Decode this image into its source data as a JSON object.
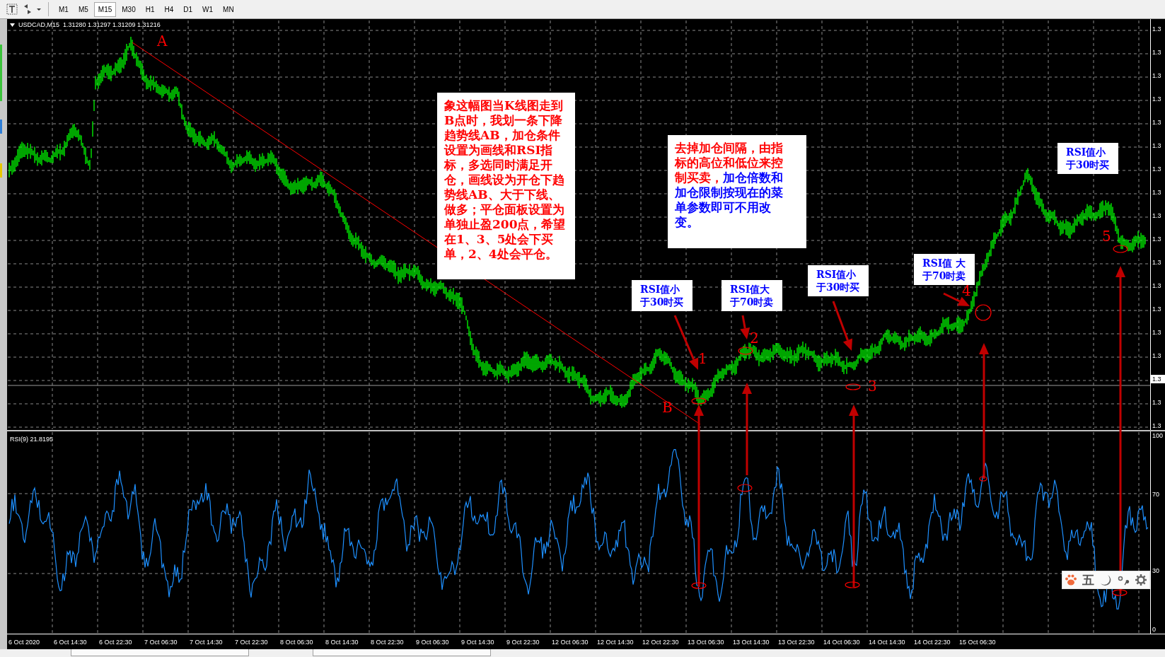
{
  "toolbar": {
    "timeframes": [
      {
        "label": "M1",
        "selected": false
      },
      {
        "label": "M5",
        "selected": false
      },
      {
        "label": "M15",
        "selected": true
      },
      {
        "label": "M30",
        "selected": false
      },
      {
        "label": "H1",
        "selected": false
      },
      {
        "label": "H4",
        "selected": false
      },
      {
        "label": "D1",
        "selected": false
      },
      {
        "label": "W1",
        "selected": false
      },
      {
        "label": "MN",
        "selected": false
      }
    ]
  },
  "chart": {
    "header": "USDCAD,M15  1.31280 1.31297 1.31209 1.31216",
    "price_axis": [
      {
        "label": "1.3",
        "current": false
      },
      {
        "label": "1.3",
        "current": false
      },
      {
        "label": "1.3",
        "current": false
      },
      {
        "label": "1.3",
        "current": false
      },
      {
        "label": "1.3",
        "current": false
      },
      {
        "label": "1.3",
        "current": false
      },
      {
        "label": "1.3",
        "current": false
      },
      {
        "label": "1.3",
        "current": false
      },
      {
        "label": "1.3",
        "current": false
      },
      {
        "label": "1.3",
        "current": false
      },
      {
        "label": "1.3",
        "current": false
      },
      {
        "label": "1.3",
        "current": false
      },
      {
        "label": "1.3",
        "current": false
      },
      {
        "label": "1.3",
        "current": false
      },
      {
        "label": "1.3",
        "current": false
      },
      {
        "label": "1.3",
        "current": true
      },
      {
        "label": "1.3",
        "current": false
      },
      {
        "label": "1.3",
        "current": false
      }
    ],
    "point_labels": [
      "A",
      "B",
      "1",
      "2",
      "3",
      "4",
      "5"
    ],
    "notes": [
      {
        "segments": [
          {
            "text": "象这幅图当K线图走到B点时，我划一条下降趋势线AB，加仓条件设置为画线和RSI指标，多选同时满足开仓，画线设为开仓下趋势线AB、大于下线、做多；平仓面板设置为单独止盈200点，希望在1、3、5处会下买单，2、4处会平仓。",
            "color": "#ff0000"
          }
        ]
      },
      {
        "segments": [
          {
            "text": "去掉加仓间隔，由指标的高位和低位来控制买卖，",
            "color": "#ff0000"
          },
          {
            "text": "加仓倍数和加仓限制按现在的菜单参数即可不用改变。",
            "color": "#0000ff"
          }
        ]
      }
    ],
    "rsi_callouts": [
      "RSI值小于30时买",
      "RSI值大于70时卖",
      "RSI值小于30时买",
      "RSI值 大于70时卖",
      "RSI值小于30时买"
    ]
  },
  "rsi": {
    "label": "RSI(9) 21.8195",
    "axis": [
      "100",
      "70",
      "30",
      "0"
    ]
  },
  "time_axis": [
    "6 Oct 2020",
    "6 Oct 14:30",
    "6 Oct 22:30",
    "7 Oct 06:30",
    "7 Oct 14:30",
    "7 Oct 22:30",
    "8 Oct 06:30",
    "8 Oct 14:30",
    "8 Oct 22:30",
    "9 Oct 06:30",
    "9 Oct 14:30",
    "9 Oct 22:30",
    "12 Oct 06:30",
    "12 Oct 14:30",
    "12 Oct 22:30",
    "13 Oct 06:30",
    "13 Oct 14:30",
    "13 Oct 22:30",
    "14 Oct 06:30",
    "14 Oct 14:30",
    "14 Oct 22:30",
    "15 Oct 06:30"
  ],
  "ime_toolbar": {
    "mode": "五"
  }
}
